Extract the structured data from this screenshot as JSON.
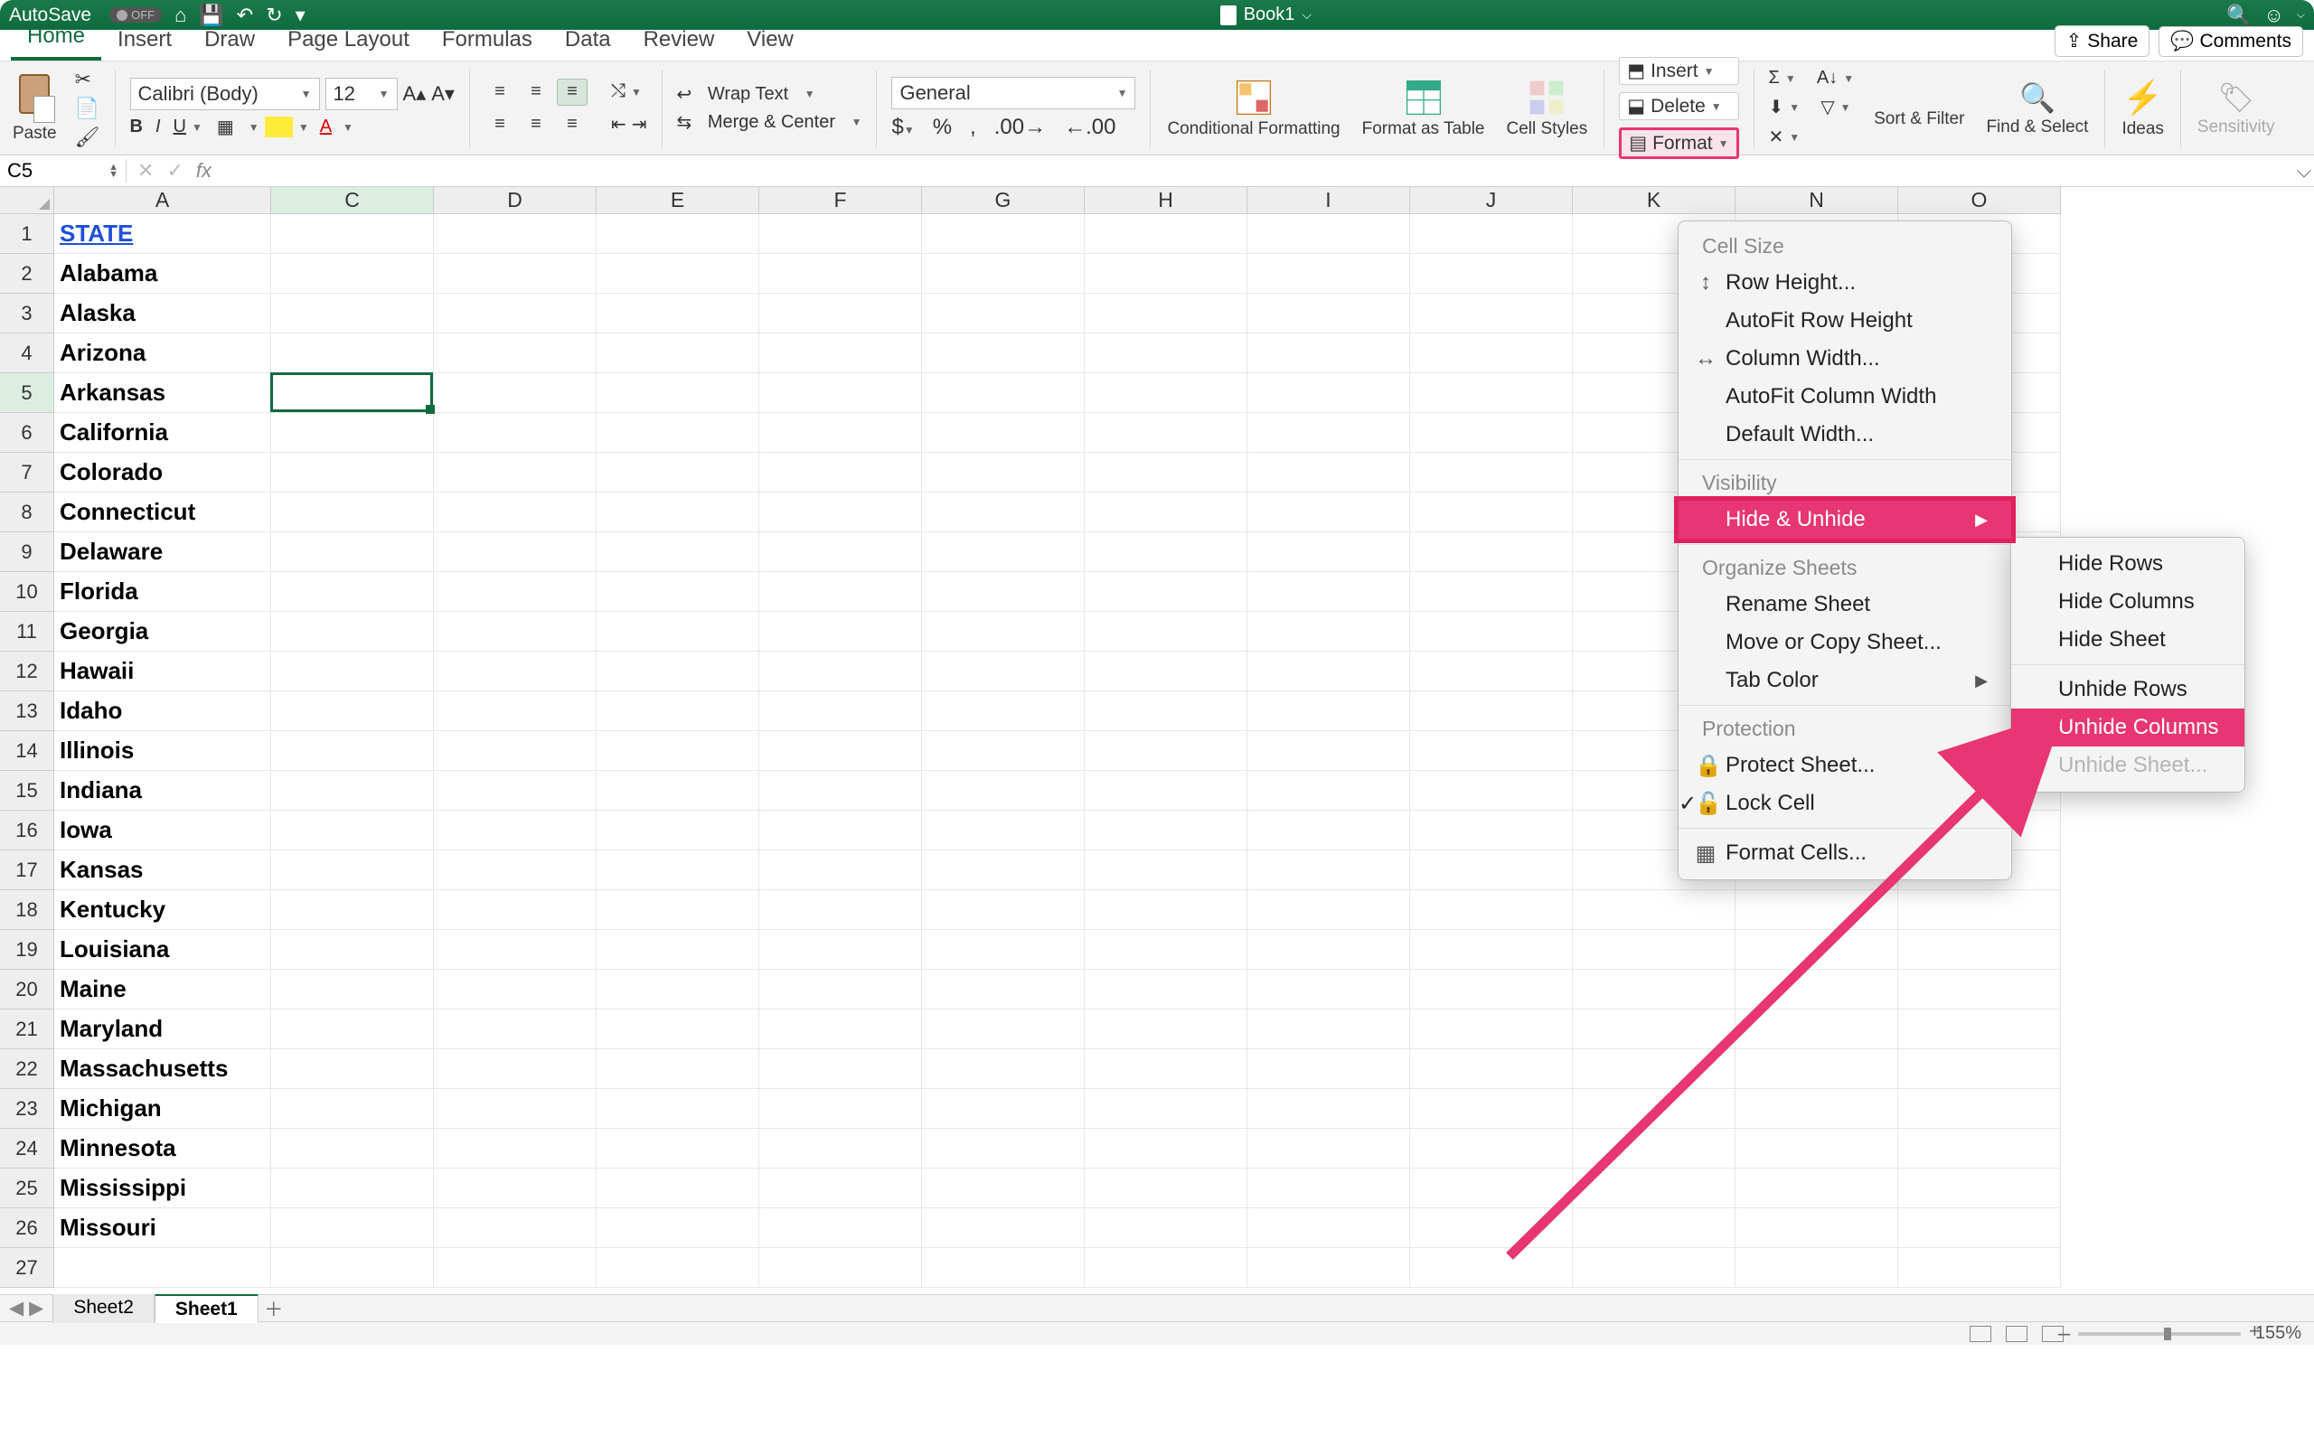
{
  "titlebar": {
    "autosave_label": "AutoSave",
    "autosave_state": "OFF",
    "doc_title": "Book1"
  },
  "tabs": [
    "Home",
    "Insert",
    "Draw",
    "Page Layout",
    "Formulas",
    "Data",
    "Review",
    "View"
  ],
  "share": {
    "share": "Share",
    "comments": "Comments"
  },
  "ribbon": {
    "paste": "Paste",
    "font_name": "Calibri (Body)",
    "font_size": "12",
    "wrap": "Wrap Text",
    "merge": "Merge & Center",
    "num_format": "General",
    "blocks": {
      "cond": "Conditional\nFormatting",
      "fmt_tbl": "Format\nas Table",
      "styles": "Cell\nStyles",
      "sort": "Sort &\nFilter",
      "find": "Find &\nSelect",
      "ideas": "Ideas",
      "sens": "Sensitivity"
    },
    "cells": {
      "insert": "Insert",
      "delete": "Delete",
      "format": "Format"
    }
  },
  "fxbar": {
    "cell_ref": "C5",
    "fx": "fx"
  },
  "columns": [
    "A",
    "C",
    "D",
    "E",
    "F",
    "G",
    "H",
    "I",
    "J",
    "K",
    "N",
    "O"
  ],
  "active_cell": {
    "row_index": 4,
    "col_index": 1
  },
  "data": {
    "header": "STATE",
    "rows": [
      "Alabama",
      "Alaska",
      "Arizona",
      "Arkansas",
      "California",
      "Colorado",
      "Connecticut",
      "Delaware",
      "Florida",
      "Georgia",
      "Hawaii",
      "Idaho",
      "Illinois",
      "Indiana",
      "Iowa",
      "Kansas",
      "Kentucky",
      "Louisiana",
      "Maine",
      "Maryland",
      "Massachusetts",
      "Michigan",
      "Minnesota",
      "Mississippi",
      "Missouri"
    ]
  },
  "sheets": {
    "tabs": [
      "Sheet2",
      "Sheet1"
    ],
    "active": 1
  },
  "status": {
    "zoom": "155%"
  },
  "format_menu": {
    "sections": [
      {
        "header": "Cell Size",
        "items": [
          {
            "label": "Row Height...",
            "icon": "↕"
          },
          {
            "label": "AutoFit Row Height"
          },
          {
            "label": "Column Width...",
            "icon": "↔"
          },
          {
            "label": "AutoFit Column Width"
          },
          {
            "label": "Default Width..."
          }
        ]
      },
      {
        "header": "Visibility",
        "items": [
          {
            "label": "Hide & Unhide",
            "sub": true,
            "highlight": true
          }
        ]
      },
      {
        "header": "Organize Sheets",
        "items": [
          {
            "label": "Rename Sheet"
          },
          {
            "label": "Move or Copy Sheet..."
          },
          {
            "label": "Tab Color",
            "sub": true
          }
        ]
      },
      {
        "header": "Protection",
        "items": [
          {
            "label": "Protect Sheet...",
            "icon": "🔒"
          },
          {
            "label": "Lock Cell",
            "icon": "🔓",
            "check": true
          }
        ]
      },
      {
        "items": [
          {
            "label": "Format Cells...",
            "icon": "▦"
          }
        ],
        "obstructed_by_arrow": true
      }
    ]
  },
  "hide_submenu": {
    "items": [
      {
        "label": "Hide Rows"
      },
      {
        "label": "Hide Columns"
      },
      {
        "label": "Hide Sheet"
      },
      {
        "sep": true
      },
      {
        "label": "Unhide Rows"
      },
      {
        "label": "Unhide Columns",
        "hover": true
      },
      {
        "label": "Unhide Sheet...",
        "disabled": true
      }
    ]
  }
}
